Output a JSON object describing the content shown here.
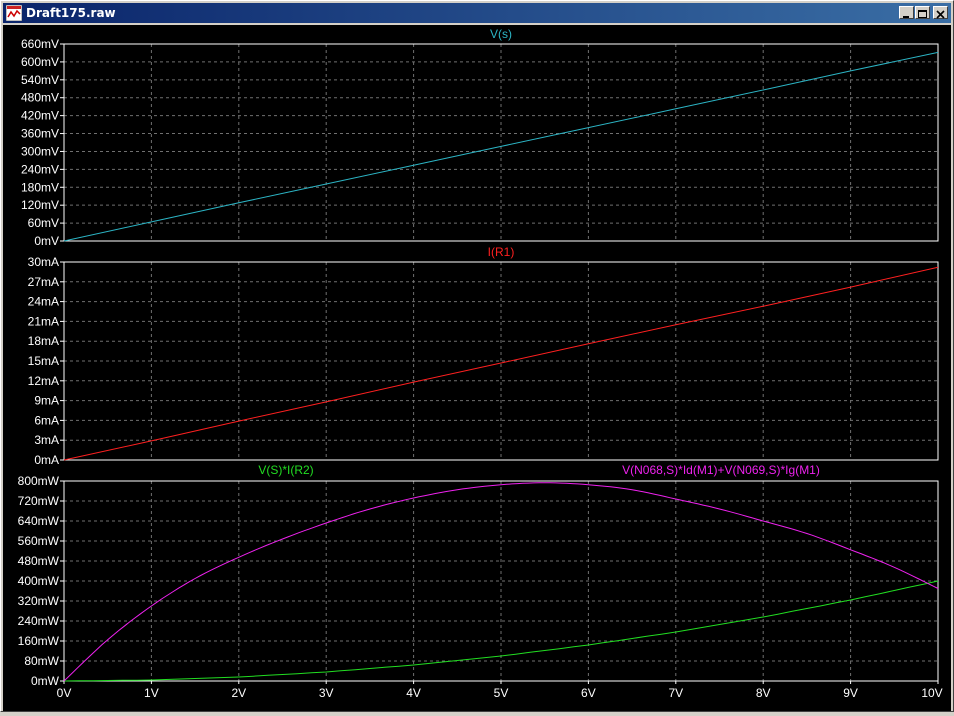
{
  "window": {
    "title": "Draft175.raw"
  },
  "title_buttons": {
    "minimize": "minimize",
    "maximize": "maximize",
    "close": "close"
  },
  "colors": {
    "frame": "#ffffff",
    "grid": "#707070",
    "background": "#000000",
    "vs": "#2cb5c5",
    "ir1": "#ff2020",
    "p_green": "#22dd22",
    "p_magenta": "#ee22ee"
  },
  "x_axis": {
    "ticks": [
      "0V",
      "1V",
      "2V",
      "3V",
      "4V",
      "5V",
      "6V",
      "7V",
      "8V",
      "9V",
      "10V"
    ]
  },
  "chart_data": [
    {
      "type": "line",
      "title": "V(s)",
      "yticks": [
        "660mV",
        "600mV",
        "540mV",
        "480mV",
        "420mV",
        "360mV",
        "300mV",
        "240mV",
        "180mV",
        "120mV",
        "60mV",
        "0mV"
      ],
      "ylim": [
        0,
        660
      ],
      "xlim": [
        0,
        10
      ],
      "grid": true,
      "series": [
        {
          "name": "V(s)",
          "color": "#2cb5c5",
          "x": [
            0,
            1,
            2,
            3,
            4,
            5,
            6,
            7,
            8,
            9,
            10
          ],
          "y": [
            0,
            64,
            128,
            191,
            254,
            317,
            380,
            443,
            506,
            570,
            632
          ]
        }
      ]
    },
    {
      "type": "line",
      "title": "I(R1)",
      "yticks": [
        "30mA",
        "27mA",
        "24mA",
        "21mA",
        "18mA",
        "15mA",
        "12mA",
        "9mA",
        "6mA",
        "3mA",
        "0mA"
      ],
      "ylim": [
        0,
        30
      ],
      "xlim": [
        0,
        10
      ],
      "grid": true,
      "series": [
        {
          "name": "I(R1)",
          "color": "#ff2020",
          "x": [
            0,
            1,
            2,
            3,
            4,
            5,
            6,
            7,
            8,
            9,
            10
          ],
          "y": [
            0,
            2.9,
            5.9,
            8.8,
            11.8,
            14.7,
            17.6,
            20.5,
            23.3,
            26.2,
            29.2
          ]
        }
      ]
    },
    {
      "type": "line",
      "yticks": [
        "800mW",
        "720mW",
        "640mW",
        "560mW",
        "480mW",
        "400mW",
        "320mW",
        "240mW",
        "160mW",
        "80mW",
        "0mW"
      ],
      "ylim": [
        0,
        800
      ],
      "xlim": [
        0,
        10
      ],
      "grid": true,
      "series": [
        {
          "name": "V(S)*I(R2)",
          "color": "#22dd22",
          "x": [
            0,
            1,
            2,
            3,
            4,
            5,
            6,
            7,
            8,
            9,
            10
          ],
          "y": [
            0,
            4,
            16,
            36,
            64,
            100,
            144,
            196,
            256,
            324,
            400
          ]
        },
        {
          "name": "V(N068,S)*Id(M1)+V(N069,S)*Ig(M1)",
          "color": "#ee22ee",
          "x": [
            0,
            0.5,
            1,
            1.5,
            2,
            2.5,
            3,
            3.5,
            4,
            4.5,
            5,
            5.5,
            6,
            6.5,
            7,
            7.5,
            8,
            8.5,
            9,
            9.5,
            10
          ],
          "y": [
            0,
            165,
            300,
            410,
            495,
            568,
            632,
            688,
            732,
            765,
            785,
            793,
            785,
            765,
            728,
            688,
            640,
            590,
            525,
            455,
            370
          ]
        }
      ]
    }
  ]
}
